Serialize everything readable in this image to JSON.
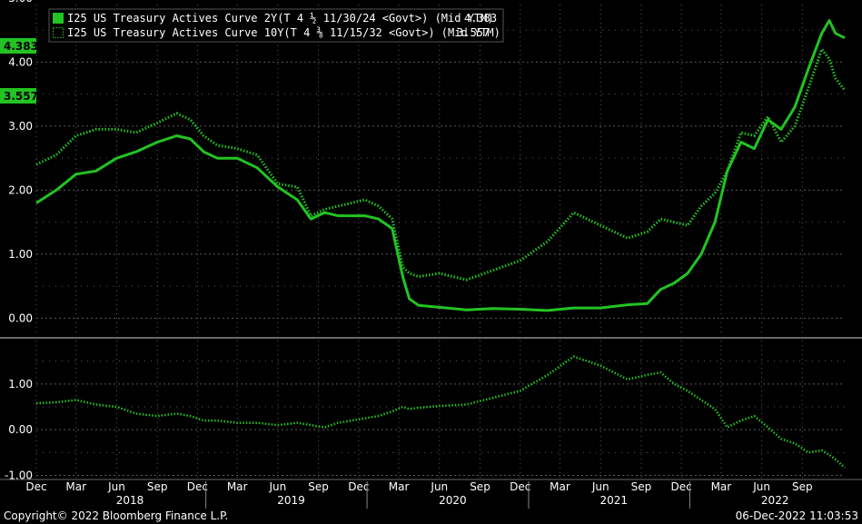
{
  "footer": {
    "copyright": "Copyright© 2022 Bloomberg Finance L.P.",
    "timestamp": "06-Dec-2022 11:03:53"
  },
  "legend": [
    {
      "label": "I25 US Treasury Actives Curve 2Y(T 4 ½ 11/30/24 <Govt>) (Mid YTM)",
      "last": "4.383",
      "style": "solid"
    },
    {
      "label": "I25 US Treasury Actives Curve 10Y(T 4 ⅜ 11/15/32 <Govt>) (Mid YTM)",
      "last": "3.557",
      "style": "dotted"
    }
  ],
  "colors": {
    "series": "#22c322",
    "badge": "#22c322",
    "grid": "#5a5a5a",
    "separator": "#6a6a6a"
  },
  "chart_data": [
    {
      "type": "line",
      "panel": "top",
      "xrange": [
        "2017-12-01",
        "2022-12-06"
      ],
      "ylim": [
        -0.25,
        4.9
      ],
      "yticks": [
        "0.00",
        "1.00",
        "2.00",
        "3.00",
        "4.00",
        "5.00"
      ],
      "grid": true,
      "series": [
        {
          "name": "I25 US Treasury Actives Curve 2Y(T 4 ½ 11/30/24 <Govt>) (Mid YTM)",
          "x": [
            "2017-12-01",
            "2018-01-15",
            "2018-03-01",
            "2018-04-15",
            "2018-06-01",
            "2018-07-15",
            "2018-09-01",
            "2018-10-15",
            "2018-11-15",
            "2018-12-15",
            "2019-01-15",
            "2019-03-01",
            "2019-04-15",
            "2019-06-01",
            "2019-07-15",
            "2019-08-15",
            "2019-09-15",
            "2019-10-15",
            "2019-11-15",
            "2019-12-15",
            "2020-01-15",
            "2020-02-15",
            "2020-03-10",
            "2020-03-25",
            "2020-04-15",
            "2020-06-01",
            "2020-08-01",
            "2020-10-01",
            "2020-12-01",
            "2021-02-01",
            "2021-04-01",
            "2021-06-01",
            "2021-08-01",
            "2021-09-15",
            "2021-10-15",
            "2021-11-15",
            "2021-12-15",
            "2022-01-15",
            "2022-02-15",
            "2022-03-15",
            "2022-04-15",
            "2022-05-15",
            "2022-06-15",
            "2022-07-15",
            "2022-08-15",
            "2022-09-15",
            "2022-10-15",
            "2022-11-01",
            "2022-11-15",
            "2022-12-06"
          ],
          "y": [
            1.8,
            2.0,
            2.25,
            2.3,
            2.5,
            2.6,
            2.75,
            2.85,
            2.8,
            2.6,
            2.5,
            2.5,
            2.35,
            2.05,
            1.85,
            1.55,
            1.65,
            1.6,
            1.6,
            1.6,
            1.55,
            1.4,
            0.65,
            0.3,
            0.2,
            0.17,
            0.13,
            0.15,
            0.14,
            0.12,
            0.16,
            0.16,
            0.21,
            0.23,
            0.45,
            0.55,
            0.7,
            1.0,
            1.5,
            2.3,
            2.75,
            2.65,
            3.1,
            2.95,
            3.3,
            3.9,
            4.45,
            4.65,
            4.45,
            4.38
          ]
        },
        {
          "name": "I25 US Treasury Actives Curve 10Y(T 4 ⅜ 11/15/32 <Govt>) (Mid YTM)",
          "x": [
            "2017-12-01",
            "2018-01-15",
            "2018-03-01",
            "2018-04-15",
            "2018-06-01",
            "2018-07-15",
            "2018-09-01",
            "2018-10-15",
            "2018-11-15",
            "2018-12-15",
            "2019-01-15",
            "2019-03-01",
            "2019-04-15",
            "2019-06-01",
            "2019-07-15",
            "2019-08-15",
            "2019-09-15",
            "2019-10-15",
            "2019-11-15",
            "2019-12-15",
            "2020-01-15",
            "2020-02-15",
            "2020-03-10",
            "2020-03-25",
            "2020-04-15",
            "2020-06-01",
            "2020-08-01",
            "2020-10-01",
            "2020-12-01",
            "2021-02-01",
            "2021-04-01",
            "2021-06-01",
            "2021-08-01",
            "2021-09-15",
            "2021-10-15",
            "2021-11-15",
            "2021-12-15",
            "2022-01-15",
            "2022-02-15",
            "2022-03-15",
            "2022-04-15",
            "2022-05-15",
            "2022-06-15",
            "2022-07-15",
            "2022-08-15",
            "2022-09-15",
            "2022-10-15",
            "2022-11-01",
            "2022-11-15",
            "2022-12-06"
          ],
          "y": [
            2.4,
            2.55,
            2.85,
            2.95,
            2.95,
            2.9,
            3.05,
            3.2,
            3.1,
            2.85,
            2.7,
            2.65,
            2.55,
            2.1,
            2.05,
            1.6,
            1.7,
            1.75,
            1.8,
            1.85,
            1.75,
            1.55,
            0.8,
            0.7,
            0.65,
            0.7,
            0.6,
            0.75,
            0.9,
            1.2,
            1.65,
            1.45,
            1.25,
            1.35,
            1.55,
            1.5,
            1.45,
            1.75,
            1.95,
            2.3,
            2.9,
            2.85,
            3.15,
            2.75,
            3.0,
            3.6,
            4.2,
            4.05,
            3.75,
            3.56
          ]
        }
      ]
    },
    {
      "type": "line",
      "panel": "bottom",
      "xrange": [
        "2017-12-01",
        "2022-12-06"
      ],
      "ylim": [
        -1.05,
        1.95
      ],
      "yticks": [
        "-1.00",
        "0.00",
        "1.00"
      ],
      "grid": true,
      "series": [
        {
          "x": [
            "2017-12-01",
            "2018-01-15",
            "2018-03-01",
            "2018-04-15",
            "2018-06-01",
            "2018-07-15",
            "2018-09-01",
            "2018-10-15",
            "2018-11-15",
            "2018-12-15",
            "2019-01-15",
            "2019-03-01",
            "2019-04-15",
            "2019-06-01",
            "2019-07-15",
            "2019-08-15",
            "2019-09-15",
            "2019-10-15",
            "2019-11-15",
            "2019-12-15",
            "2020-01-15",
            "2020-02-15",
            "2020-03-10",
            "2020-03-25",
            "2020-04-15",
            "2020-06-01",
            "2020-08-01",
            "2020-10-01",
            "2020-12-01",
            "2021-02-01",
            "2021-04-01",
            "2021-06-01",
            "2021-08-01",
            "2021-09-15",
            "2021-10-15",
            "2021-11-15",
            "2021-12-15",
            "2022-01-15",
            "2022-02-15",
            "2022-03-15",
            "2022-04-15",
            "2022-05-15",
            "2022-06-15",
            "2022-07-15",
            "2022-08-15",
            "2022-09-15",
            "2022-10-15",
            "2022-11-01",
            "2022-11-15",
            "2022-12-06"
          ],
          "y": [
            0.58,
            0.6,
            0.65,
            0.55,
            0.5,
            0.35,
            0.3,
            0.35,
            0.3,
            0.2,
            0.2,
            0.15,
            0.15,
            0.1,
            0.15,
            0.1,
            0.05,
            0.15,
            0.2,
            0.25,
            0.3,
            0.4,
            0.5,
            0.45,
            0.48,
            0.52,
            0.55,
            0.7,
            0.85,
            1.2,
            1.6,
            1.4,
            1.1,
            1.2,
            1.25,
            1.0,
            0.85,
            0.65,
            0.45,
            0.05,
            0.2,
            0.3,
            0.05,
            -0.2,
            -0.3,
            -0.5,
            -0.45,
            -0.55,
            -0.65,
            -0.83
          ]
        }
      ]
    }
  ],
  "x_axis": {
    "months": [
      {
        "label": "Dec",
        "date": "2017-12-01"
      },
      {
        "label": "Mar",
        "date": "2018-03-01"
      },
      {
        "label": "Jun",
        "date": "2018-06-01"
      },
      {
        "label": "Sep",
        "date": "2018-09-01"
      },
      {
        "label": "Dec",
        "date": "2018-12-01"
      },
      {
        "label": "Mar",
        "date": "2019-03-01"
      },
      {
        "label": "Jun",
        "date": "2019-06-01"
      },
      {
        "label": "Sep",
        "date": "2019-09-01"
      },
      {
        "label": "Dec",
        "date": "2019-12-01"
      },
      {
        "label": "Mar",
        "date": "2020-03-01"
      },
      {
        "label": "Jun",
        "date": "2020-06-01"
      },
      {
        "label": "Sep",
        "date": "2020-09-01"
      },
      {
        "label": "Dec",
        "date": "2020-12-01"
      },
      {
        "label": "Mar",
        "date": "2021-03-01"
      },
      {
        "label": "Jun",
        "date": "2021-06-01"
      },
      {
        "label": "Sep",
        "date": "2021-09-01"
      },
      {
        "label": "Dec",
        "date": "2021-12-01"
      },
      {
        "label": "Mar",
        "date": "2022-03-01"
      },
      {
        "label": "Jun",
        "date": "2022-06-01"
      },
      {
        "label": "Sep",
        "date": "2022-09-01"
      }
    ],
    "years": [
      {
        "label": "2018",
        "date": "2018-07-01"
      },
      {
        "label": "2019",
        "date": "2019-07-01"
      },
      {
        "label": "2020",
        "date": "2020-07-01"
      },
      {
        "label": "2021",
        "date": "2021-07-01"
      },
      {
        "label": "2022",
        "date": "2022-07-01"
      }
    ],
    "year_boundaries": [
      "2018-12-20",
      "2019-12-20",
      "2020-12-20",
      "2021-12-20"
    ]
  }
}
